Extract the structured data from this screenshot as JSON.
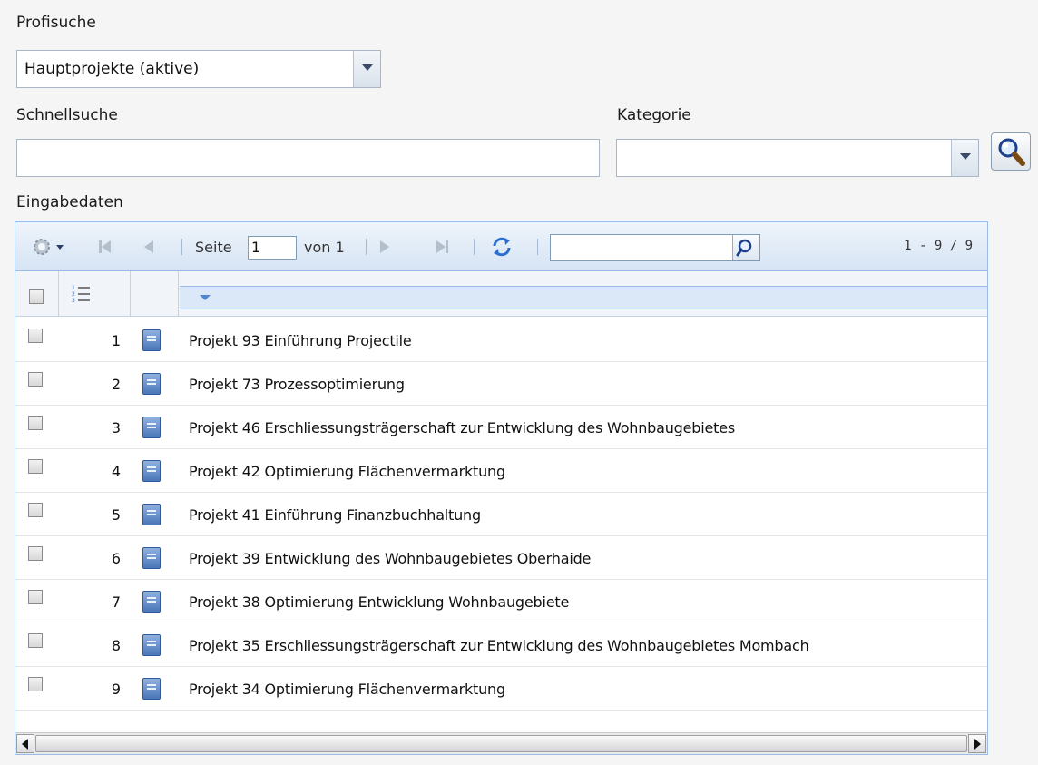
{
  "profisuche": {
    "label": "Profisuche",
    "selected": "Hauptprojekte (aktive)"
  },
  "schnellsuche": {
    "label": "Schnellsuche",
    "value": ""
  },
  "kategorie": {
    "label": "Kategorie",
    "value": ""
  },
  "search_button": {
    "icon": "magnifier-icon"
  },
  "eingabedaten": {
    "label": "Eingabedaten"
  },
  "grid": {
    "toolbar": {
      "settings_icon": "gear-icon",
      "page_label": "Seite",
      "page_value": "1",
      "of_label": "von 1",
      "refresh_icon": "refresh-icon",
      "search_value": "",
      "count": "1 - 9 / 9"
    },
    "rows": [
      {
        "num": "1",
        "title": "Projekt 93 Einführung Projectile"
      },
      {
        "num": "2",
        "title": "Projekt 73 Prozessoptimierung"
      },
      {
        "num": "3",
        "title": "Projekt 46 Erschliessungsträgerschaft zur Entwicklung des Wohnbaugebietes"
      },
      {
        "num": "4",
        "title": "Projekt 42 Optimierung Flächenvermarktung"
      },
      {
        "num": "5",
        "title": "Projekt 41 Einführung Finanzbuchhaltung"
      },
      {
        "num": "6",
        "title": "Projekt 39 Entwicklung des Wohnbaugebietes Oberhaide"
      },
      {
        "num": "7",
        "title": "Projekt 38 Optimierung Entwicklung Wohnbaugebiete"
      },
      {
        "num": "8",
        "title": "Projekt 35 Erschliessungsträgerschaft zur Entwicklung des Wohnbaugebietes Mombach"
      },
      {
        "num": "9",
        "title": "Projekt 34 Optimierung Flächenvermarktung"
      }
    ]
  },
  "colors": {
    "grid_border": "#99bbe8",
    "header_highlight": "#dbe8f7",
    "icon_blue": "#4a76b8"
  }
}
